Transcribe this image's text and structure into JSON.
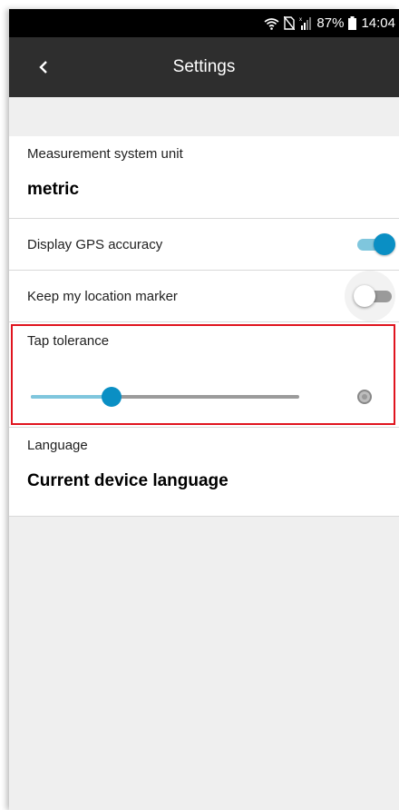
{
  "status_bar": {
    "battery_percent": "87%",
    "time": "14:04"
  },
  "app_bar": {
    "title": "Settings",
    "back_icon": "chevron-left-icon"
  },
  "settings": {
    "measurement": {
      "label": "Measurement system unit",
      "value": "metric"
    },
    "gps_accuracy": {
      "label": "Display GPS accuracy",
      "enabled": true
    },
    "location_marker": {
      "label": "Keep my location marker",
      "enabled": false
    },
    "tap_tolerance": {
      "label": "Tap tolerance",
      "level": 0.3
    },
    "language": {
      "label": "Language",
      "value": "Current device language"
    }
  },
  "colors": {
    "accent": "#0a8fc4",
    "accent_light": "#7fc6dd",
    "highlight": "#e0141e",
    "app_bar": "#2e2e2e"
  }
}
